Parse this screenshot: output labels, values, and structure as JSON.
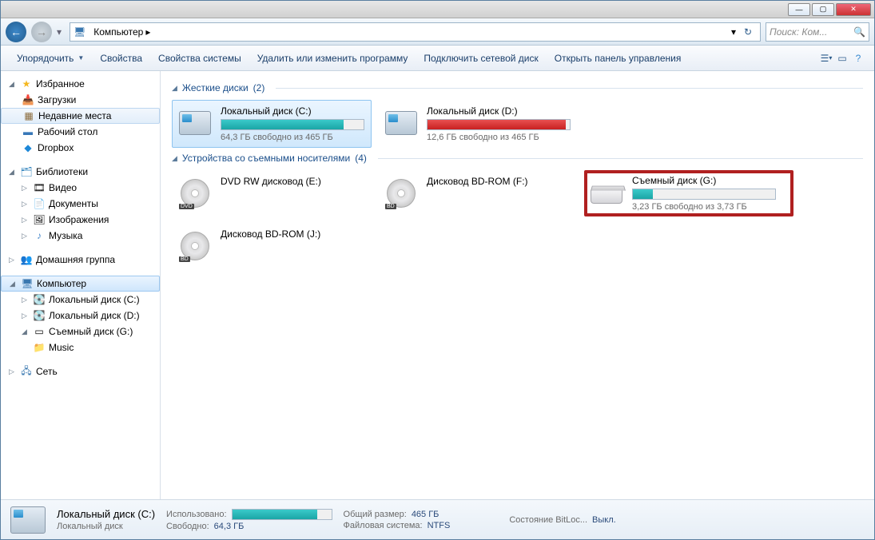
{
  "titlebar": {
    "min": "—",
    "max": "▢",
    "close": "✕"
  },
  "nav": {
    "back": "←",
    "fwd": "→",
    "dd": "▾",
    "crumb_computer": "Компьютер",
    "crumb_arrow": "▸",
    "refresh": "↻",
    "search_placeholder": "Поиск: Ком..."
  },
  "toolbar": {
    "organize": "Упорядочить",
    "properties": "Свойства",
    "sysprops": "Свойства системы",
    "uninstall": "Удалить или изменить программу",
    "mapdrive": "Подключить сетевой диск",
    "controlpanel": "Открыть панель управления"
  },
  "sidebar": {
    "favorites": "Избранное",
    "downloads": "Загрузки",
    "recent": "Недавние места",
    "desktop": "Рабочий стол",
    "dropbox": "Dropbox",
    "libraries": "Библиотеки",
    "videos": "Видео",
    "documents": "Документы",
    "pictures": "Изображения",
    "music": "Музыка",
    "homegroup": "Домашняя группа",
    "computer": "Компьютер",
    "localC": "Локальный диск (C:)",
    "localD": "Локальный диск (D:)",
    "removG": "Съемный диск (G:)",
    "musicfolder": "Music",
    "network": "Сеть"
  },
  "content": {
    "group_hdd": "Жесткие диски",
    "group_hdd_count": "(2)",
    "group_remov": "Устройства со съемными носителями",
    "group_remov_count": "(4)",
    "driveC": {
      "name": "Локальный диск (C:)",
      "free": "64,3 ГБ свободно из 465 ГБ",
      "pct": 86
    },
    "driveD": {
      "name": "Локальный диск (D:)",
      "free": "12,6 ГБ свободно из 465 ГБ",
      "pct": 97
    },
    "dvdE": {
      "name": "DVD RW дисковод (E:)",
      "badge": "DVD"
    },
    "bdF": {
      "name": "Дисковод BD-ROM (F:)",
      "badge": "BD"
    },
    "bdJ": {
      "name": "Дисковод BD-ROM (J:)",
      "badge": "BD"
    },
    "usbG": {
      "name": "Съемный диск (G:)",
      "free": "3,23 ГБ свободно из 3,73 ГБ",
      "pct": 14
    }
  },
  "status": {
    "name": "Локальный диск (C:)",
    "sub": "Локальный диск",
    "used_lbl": "Использовано:",
    "used_pct": 86,
    "free_lbl": "Свободно:",
    "free_val": "64,3 ГБ",
    "total_lbl": "Общий размер:",
    "total_val": "465 ГБ",
    "fs_lbl": "Файловая система:",
    "fs_val": "NTFS",
    "bitlocker_lbl": "Состояние BitLoc...",
    "bitlocker_val": "Выкл."
  }
}
